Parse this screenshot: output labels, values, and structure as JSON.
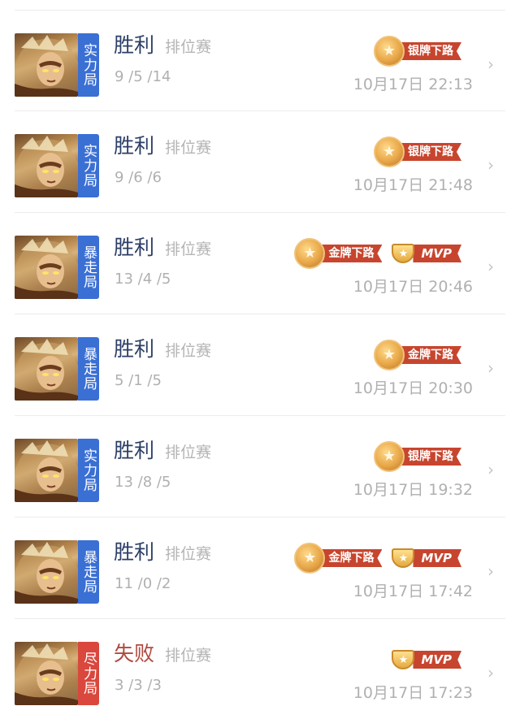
{
  "colors": {
    "mode_blue": "#3a6fd4",
    "mode_red": "#d9473d",
    "win_text": "#2c3e66",
    "lose_text": "#b04a40",
    "ribbon_red": "#c7452e",
    "muted_gray": "#b0b0b0"
  },
  "icons": {
    "medal": "star-medal-icon",
    "trophy": "trophy-icon",
    "chevron": "chevron-right-icon"
  },
  "matches": [
    {
      "mode": "实力局",
      "mode_color": "#3a6fd4",
      "result": "胜利",
      "is_win": true,
      "match_type": "排位赛",
      "kda": "9 /5 /14",
      "time": "10月17日 22:13",
      "badges": [
        {
          "kind": "medal",
          "label": "银牌下路"
        }
      ]
    },
    {
      "mode": "实力局",
      "mode_color": "#3a6fd4",
      "result": "胜利",
      "is_win": true,
      "match_type": "排位赛",
      "kda": "9 /6 /6",
      "time": "10月17日 21:48",
      "badges": [
        {
          "kind": "medal",
          "label": "银牌下路"
        }
      ]
    },
    {
      "mode": "暴走局",
      "mode_color": "#3a6fd4",
      "result": "胜利",
      "is_win": true,
      "match_type": "排位赛",
      "kda": "13 /4 /5",
      "time": "10月17日 20:46",
      "badges": [
        {
          "kind": "medal",
          "label": "金牌下路"
        },
        {
          "kind": "mvp",
          "label": "MVP"
        }
      ]
    },
    {
      "mode": "暴走局",
      "mode_color": "#3a6fd4",
      "result": "胜利",
      "is_win": true,
      "match_type": "排位赛",
      "kda": "5 /1 /5",
      "time": "10月17日 20:30",
      "badges": [
        {
          "kind": "medal",
          "label": "金牌下路"
        }
      ]
    },
    {
      "mode": "实力局",
      "mode_color": "#3a6fd4",
      "result": "胜利",
      "is_win": true,
      "match_type": "排位赛",
      "kda": "13 /8 /5",
      "time": "10月17日 19:32",
      "badges": [
        {
          "kind": "medal",
          "label": "银牌下路"
        }
      ]
    },
    {
      "mode": "暴走局",
      "mode_color": "#3a6fd4",
      "result": "胜利",
      "is_win": true,
      "match_type": "排位赛",
      "kda": "11 /0 /2",
      "time": "10月17日 17:42",
      "badges": [
        {
          "kind": "medal",
          "label": "金牌下路"
        },
        {
          "kind": "mvp",
          "label": "MVP"
        }
      ]
    },
    {
      "mode": "尽力局",
      "mode_color": "#d9473d",
      "result": "失败",
      "is_win": false,
      "match_type": "排位赛",
      "kda": "3 /3 /3",
      "time": "10月17日 17:23",
      "badges": [
        {
          "kind": "mvp",
          "label": "MVP"
        }
      ]
    }
  ]
}
